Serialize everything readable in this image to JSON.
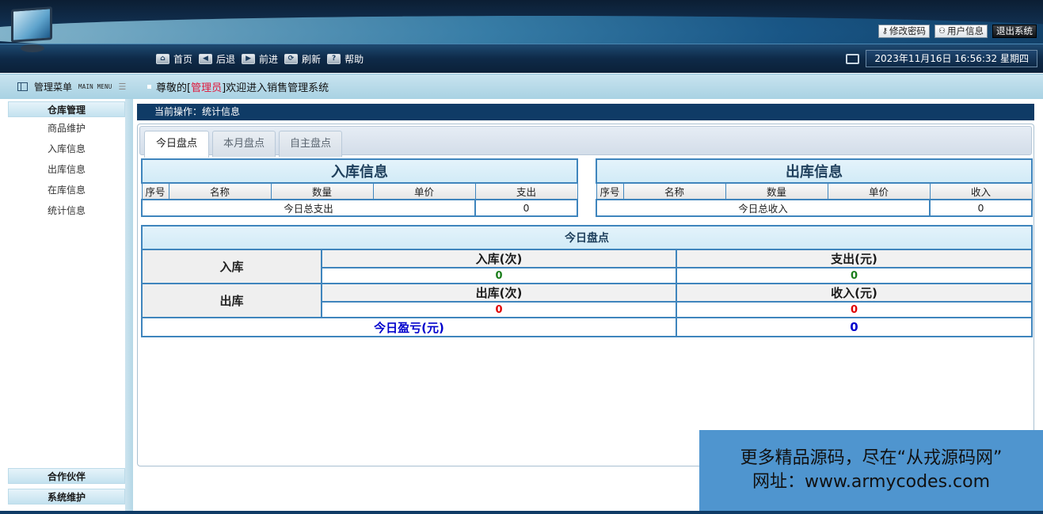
{
  "header": {
    "top_links": [
      {
        "label": "修改密码",
        "icon": "key-icon"
      },
      {
        "label": "用户信息",
        "icon": "user-icon"
      },
      {
        "label": "退出系统",
        "icon": ""
      }
    ],
    "nav": [
      {
        "label": "首页",
        "icon": "home-icon"
      },
      {
        "label": "后退",
        "icon": "back-arrow-icon"
      },
      {
        "label": "前进",
        "icon": "forward-arrow-icon"
      },
      {
        "label": "刷新",
        "icon": "refresh-icon"
      },
      {
        "label": "帮助",
        "icon": "help-icon"
      }
    ],
    "datetime": "2023年11月16日 16:56:32 星期四"
  },
  "sidebar": {
    "title": "管理菜单",
    "subtitle": "MAIN MENU",
    "sections": [
      {
        "title": "仓库管理",
        "items": [
          "商品维护",
          "入库信息",
          "出库信息",
          "在库信息",
          "统计信息"
        ]
      },
      {
        "title": "合作伙伴",
        "items": []
      },
      {
        "title": "系统维护",
        "items": []
      }
    ]
  },
  "welcome": {
    "prefix": "尊敬的[",
    "role": "管理员",
    "suffix": "]欢迎进入销售管理系统"
  },
  "current_operation": "当前操作：统计信息",
  "tabs": [
    {
      "label": "今日盘点",
      "active": true
    },
    {
      "label": "本月盘点",
      "active": false
    },
    {
      "label": "自主盘点",
      "active": false
    }
  ],
  "in_table": {
    "title": "入库信息",
    "columns": [
      "序号",
      "名称",
      "数量",
      "单价",
      "支出"
    ],
    "total_label": "今日总支出",
    "total_value": "0"
  },
  "out_table": {
    "title": "出库信息",
    "columns": [
      "序号",
      "名称",
      "数量",
      "单价",
      "收入"
    ],
    "total_label": "今日总收入",
    "total_value": "0"
  },
  "summary": {
    "title": "今日盘点",
    "in_label": "入库",
    "in_count_header": "入库(次)",
    "in_count": "0",
    "expense_header": "支出(元)",
    "expense": "0",
    "out_label": "出库",
    "out_count_header": "出库(次)",
    "out_count": "0",
    "income_header": "收入(元)",
    "income": "0",
    "profit_label": "今日盈亏(元)",
    "profit": "0"
  },
  "watermark": {
    "line1": "更多精品源码，尽在“从戎源码网”",
    "line2": "网址：www.armycodes.com"
  }
}
